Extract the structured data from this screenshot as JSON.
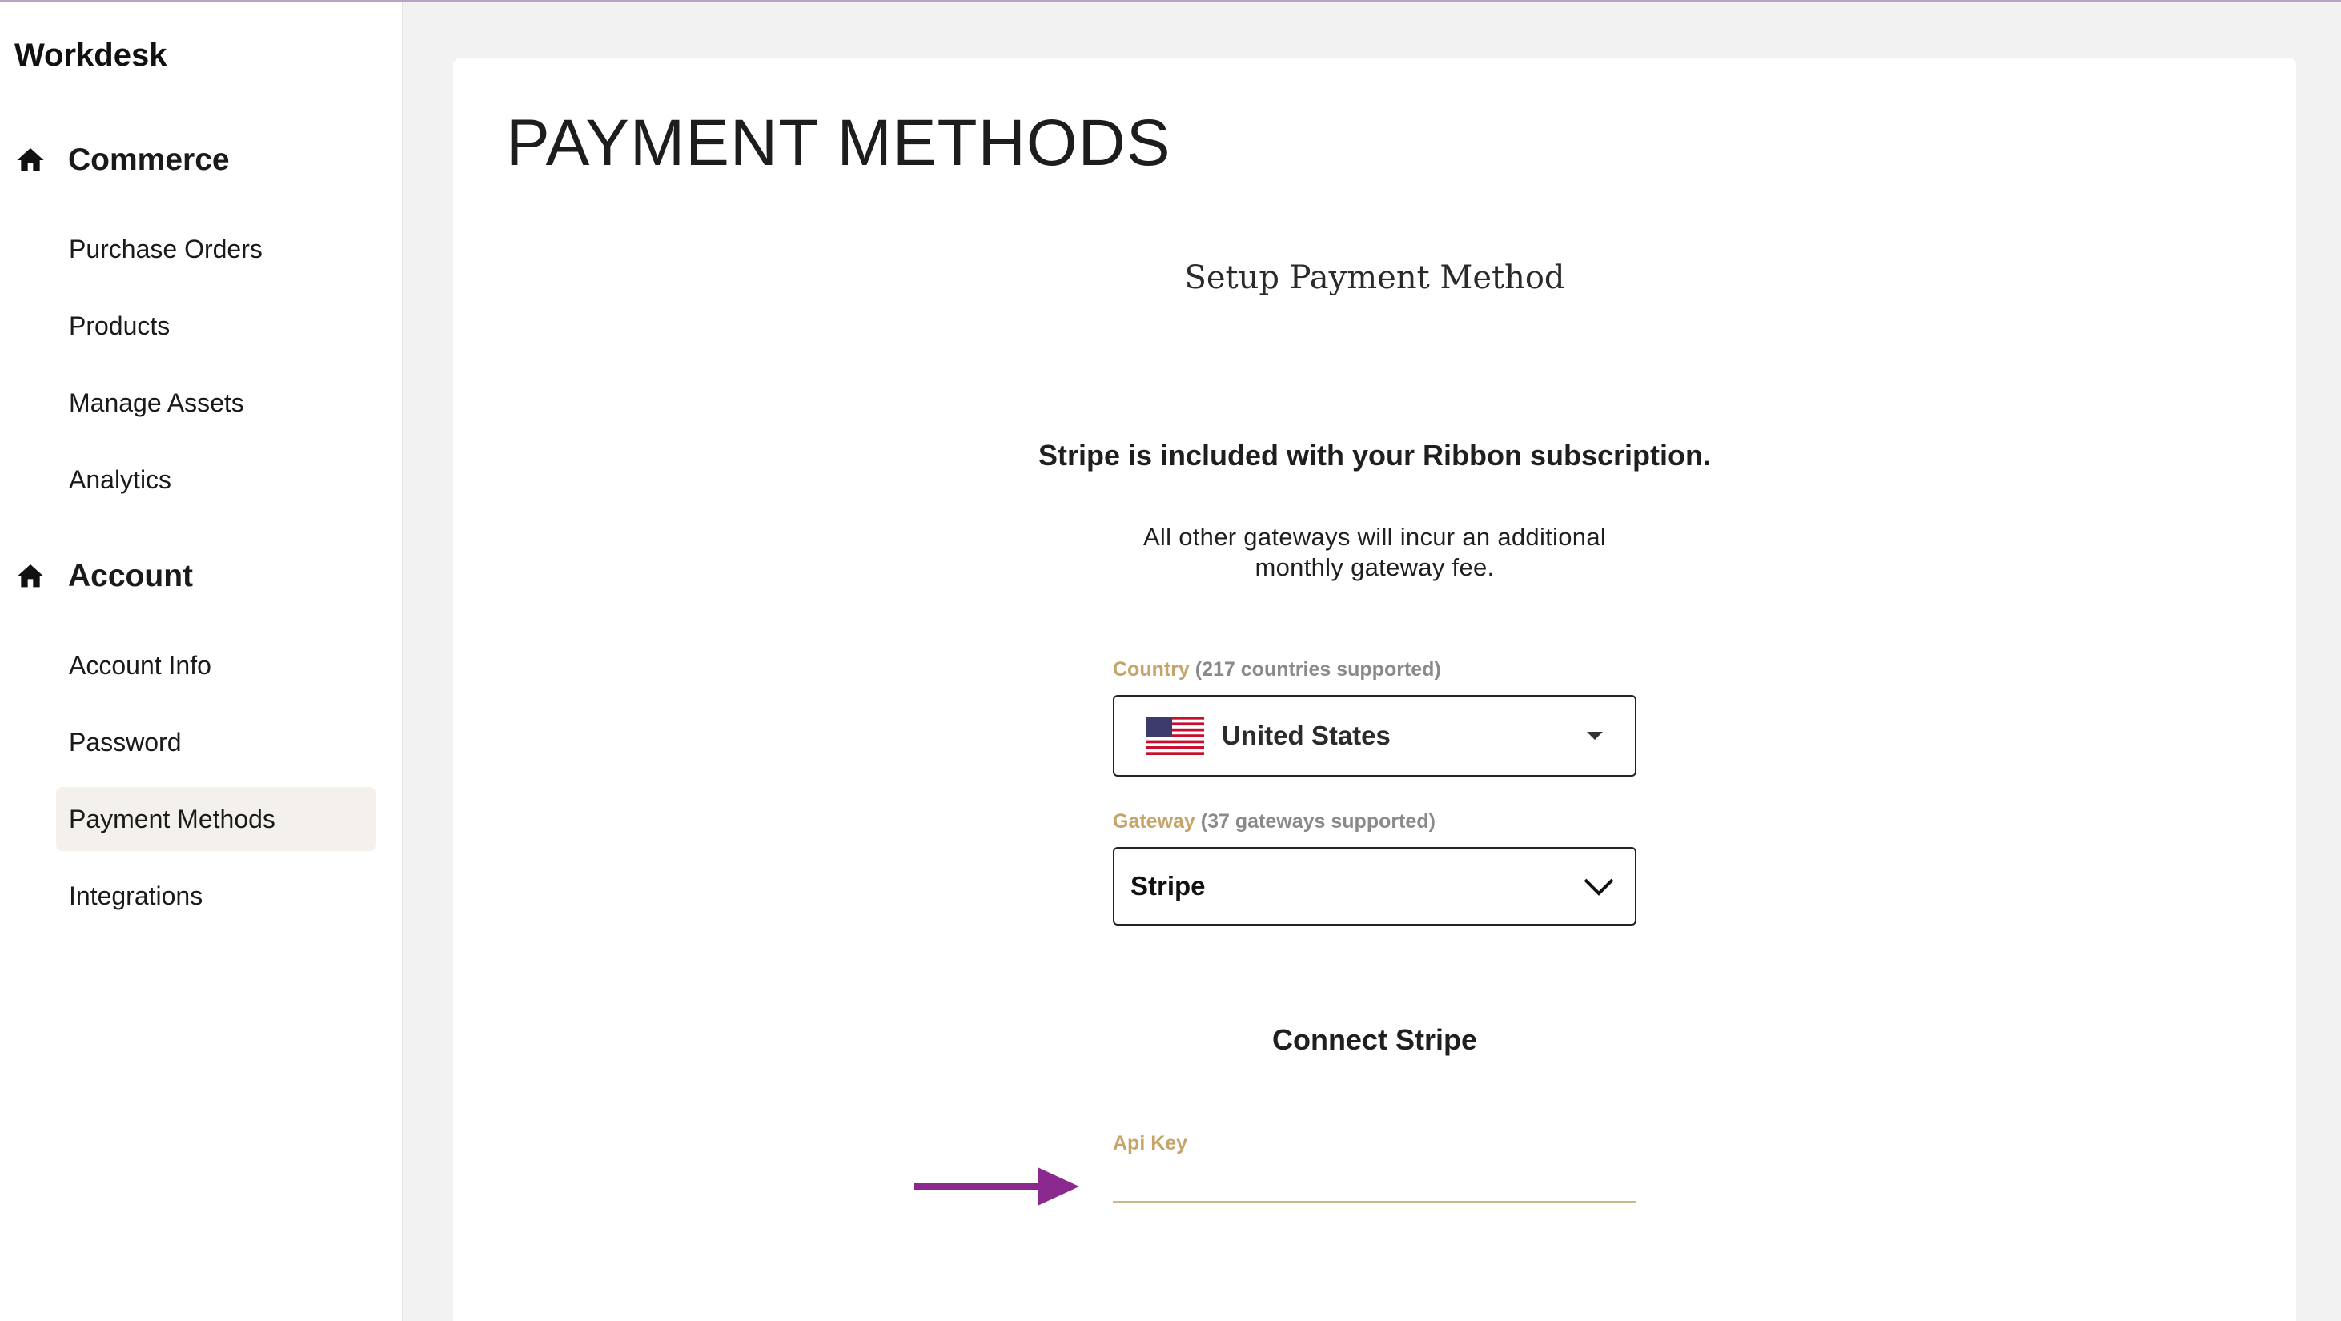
{
  "app": {
    "brand": "Workdesk"
  },
  "sidebar": {
    "sections": [
      {
        "title": "Commerce",
        "icon": "home-icon",
        "items": [
          {
            "label": "Purchase Orders"
          },
          {
            "label": "Products"
          },
          {
            "label": "Manage Assets"
          },
          {
            "label": "Analytics"
          }
        ]
      },
      {
        "title": "Account",
        "icon": "home-icon",
        "items": [
          {
            "label": "Account Info"
          },
          {
            "label": "Password"
          },
          {
            "label": "Payment Methods",
            "active": true
          },
          {
            "label": "Integrations"
          }
        ]
      }
    ]
  },
  "main": {
    "page_title": "PAYMENT METHODS",
    "subheading": "Setup Payment Method",
    "included_note": "Stripe is included with your Ribbon subscription.",
    "fee_note": "All other gateways will incur an additional monthly gateway fee.",
    "country": {
      "label": "Country",
      "hint": "(217 countries supported)",
      "value": "United States",
      "flag_icon": "us-flag-icon"
    },
    "gateway": {
      "label": "Gateway",
      "hint": "(37 gateways supported)",
      "value": "Stripe"
    },
    "connect_heading": "Connect Stripe",
    "api_key": {
      "label": "Api Key",
      "value": ""
    }
  },
  "colors": {
    "accent_gold": "#c4a468",
    "annotation_arrow": "#8a2a8f",
    "active_nav_bg": "#f4f1ec"
  }
}
